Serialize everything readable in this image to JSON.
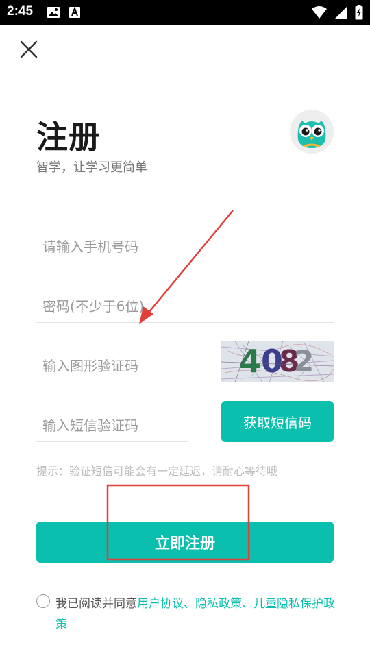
{
  "status_bar": {
    "time": "2:45",
    "icons": [
      "image-icon",
      "font-icon",
      "wifi-icon",
      "signal-icon",
      "battery-charging-icon"
    ]
  },
  "header": {
    "close_icon": "close-icon",
    "title": "注册",
    "subtitle": "智学，让学习更简单",
    "logo_icon": "owl-logo-icon"
  },
  "form": {
    "phone": {
      "placeholder": "请输入手机号码",
      "value": ""
    },
    "password": {
      "placeholder": "密码(不少于6位)",
      "value": ""
    },
    "captcha": {
      "placeholder": "输入图形验证码",
      "value": "",
      "image_text": "4082"
    },
    "sms": {
      "placeholder": "输入短信验证码",
      "value": "",
      "button_label": "获取短信码"
    },
    "hint": "提示：验证短信可能会有一定延迟，请耐心等待哦",
    "submit_label": "立即注册"
  },
  "agreement": {
    "prefix": "我已阅读并同意",
    "user_agreement": "用户协议",
    "sep1": "、",
    "privacy_policy": "隐私政策",
    "sep2": "、",
    "child_privacy_policy": "儿童隐私保护政策"
  },
  "colors": {
    "accent": "#0abfae",
    "annotation": "#e0403a",
    "status_bar": "#000000"
  }
}
